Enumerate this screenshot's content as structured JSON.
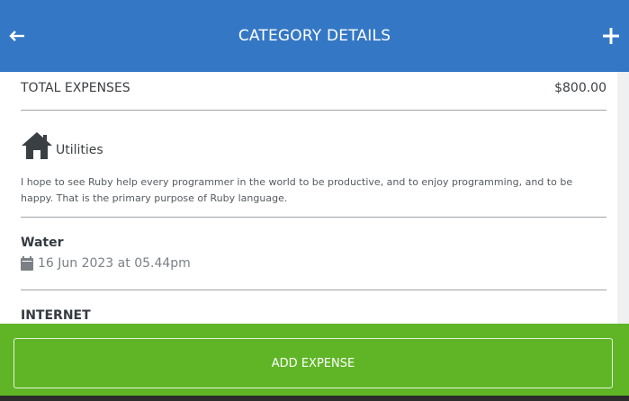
{
  "header": {
    "title": "CATEGORY DETAILS",
    "back_icon": "arrow-left-icon",
    "add_icon": "plus-icon",
    "color": "#3478c5"
  },
  "summary": {
    "label": "TOTAL EXPENSES",
    "amount": "$800.00"
  },
  "category": {
    "icon": "house-icon",
    "name": "Utilities",
    "description": "I hope to see Ruby help every programmer in the world to be productive, and to enjoy programming, and to be happy. That is the primary purpose of Ruby language."
  },
  "expenses": [
    {
      "name": "Water",
      "date": "16 Jun 2023 at 05.44pm",
      "date_icon": "calendar-icon"
    },
    {
      "name": "INTERNET"
    }
  ],
  "footer": {
    "button_label": "ADD EXPENSE",
    "color": "#5fb526"
  }
}
